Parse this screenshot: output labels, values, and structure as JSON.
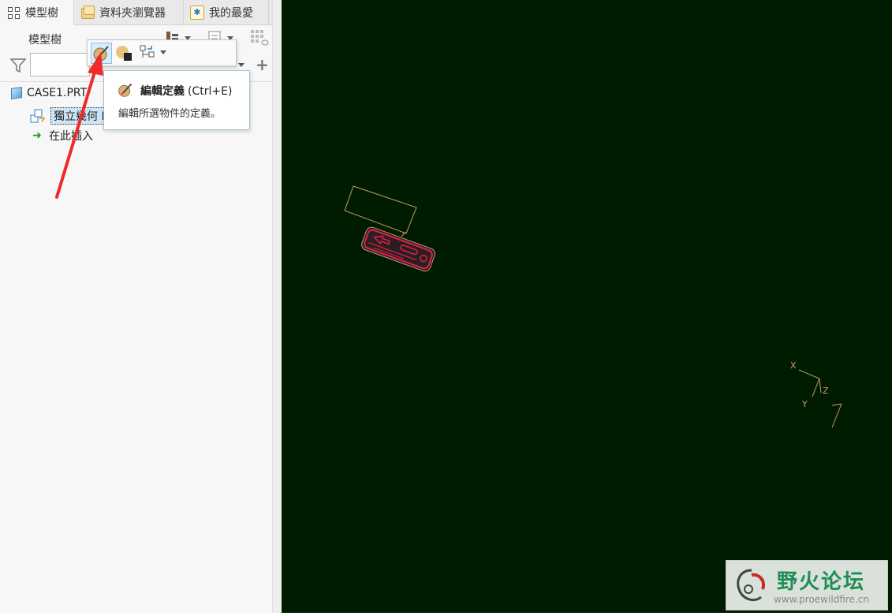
{
  "tabs": [
    {
      "label": "模型樹",
      "icon": "model-tree-icon",
      "active": true
    },
    {
      "label": "資料夾瀏覽器",
      "icon": "folder-icon",
      "active": false
    },
    {
      "label": "我的最愛",
      "icon": "favorites-icon",
      "active": false
    }
  ],
  "panel": {
    "title": "模型樹",
    "search_value": ""
  },
  "tree": {
    "root_label": "CASE1.PRT",
    "feature_label": "獨立幾何 I",
    "insert_label": "在此插入"
  },
  "tooltip": {
    "title": "編輯定義",
    "shortcut": "(Ctrl+E)",
    "description": "編輯所選物件的定義。"
  },
  "csys": {
    "x_label": "X",
    "y_label": "Y",
    "z_label": "Z"
  },
  "watermark": {
    "title": "野火论坛",
    "url": "www.proewildfire.cn"
  },
  "colors": {
    "viewport_bg": "#001c00",
    "highlight_red": "#e0204a",
    "annotation_arrow": "#ee2b2b",
    "sketch_line": "#c89a6a"
  }
}
